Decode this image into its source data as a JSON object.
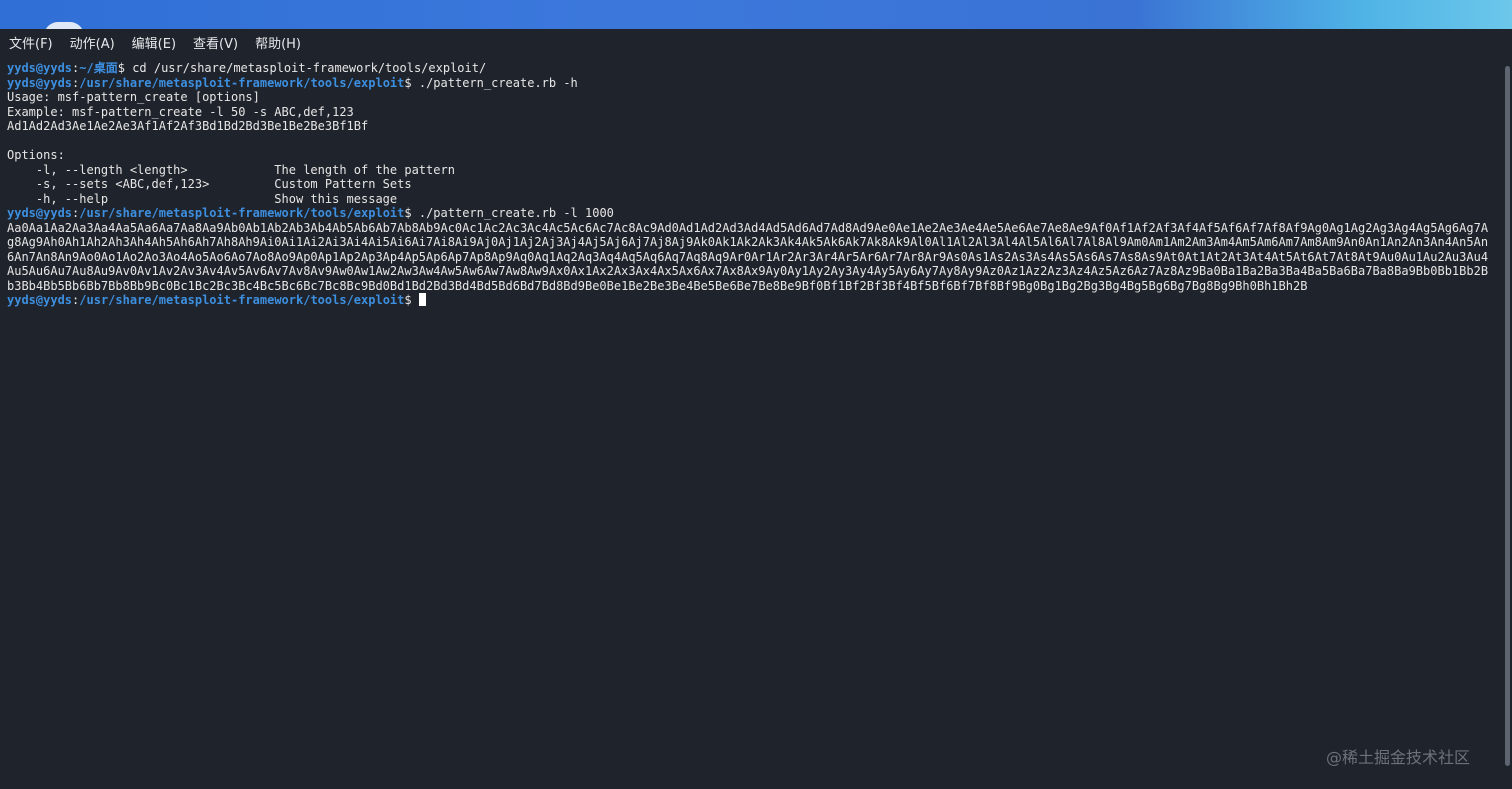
{
  "menubar": {
    "items": [
      "文件(F)",
      "动作(A)",
      "编辑(E)",
      "查看(V)",
      "帮助(H)"
    ]
  },
  "terminal": {
    "prompts": [
      {
        "user": "yyds@yyds",
        "path": "~/桌面",
        "command": "cd /usr/share/metasploit-framework/tools/exploit/"
      },
      {
        "user": "yyds@yyds",
        "path": "/usr/share/metasploit-framework/tools/exploit",
        "command": "./pattern_create.rb -h"
      }
    ],
    "help_lines": [
      "Usage: msf-pattern_create [options]",
      "Example: msf-pattern_create -l 50 -s ABC,def,123",
      "Ad1Ad2Ad3Ae1Ae2Ae3Af1Af2Af3Bd1Bd2Bd3Be1Be2Be3Bf1Bf",
      "",
      "Options:",
      "    -l, --length <length>            The length of the pattern",
      "    -s, --sets <ABC,def,123>         Custom Pattern Sets",
      "    -h, --help                       Show this message"
    ],
    "prompt3": {
      "user": "yyds@yyds",
      "path": "/usr/share/metasploit-framework/tools/exploit",
      "command": "./pattern_create.rb -l 1000"
    },
    "pattern_lines": [
      "Aa0Aa1Aa2Aa3Aa4Aa5Aa6Aa7Aa8Aa9Ab0Ab1Ab2Ab3Ab4Ab5Ab6Ab7Ab8Ab9Ac0Ac1Ac2Ac3Ac4Ac5Ac6Ac7Ac8Ac9Ad0Ad1Ad2Ad3Ad4Ad5Ad6Ad7Ad8Ad9Ae0Ae1Ae2Ae3Ae4Ae5Ae6Ae7Ae8Ae9Af0Af1Af2Af3Af4Af5Af6Af7Af8Af9Ag0Ag1Ag2Ag3Ag4Ag5Ag6Ag7A",
      "g8Ag9Ah0Ah1Ah2Ah3Ah4Ah5Ah6Ah7Ah8Ah9Ai0Ai1Ai2Ai3Ai4Ai5Ai6Ai7Ai8Ai9Aj0Aj1Aj2Aj3Aj4Aj5Aj6Aj7Aj8Aj9Ak0Ak1Ak2Ak3Ak4Ak5Ak6Ak7Ak8Ak9Al0Al1Al2Al3Al4Al5Al6Al7Al8Al9Am0Am1Am2Am3Am4Am5Am6Am7Am8Am9An0An1An2An3An4An5An",
      "6An7An8An9Ao0Ao1Ao2Ao3Ao4Ao5Ao6Ao7Ao8Ao9Ap0Ap1Ap2Ap3Ap4Ap5Ap6Ap7Ap8Ap9Aq0Aq1Aq2Aq3Aq4Aq5Aq6Aq7Aq8Aq9Ar0Ar1Ar2Ar3Ar4Ar5Ar6Ar7Ar8Ar9As0As1As2As3As4As5As6As7As8As9At0At1At2At3At4At5At6At7At8At9Au0Au1Au2Au3Au4",
      "Au5Au6Au7Au8Au9Av0Av1Av2Av3Av4Av5Av6Av7Av8Av9Aw0Aw1Aw2Aw3Aw4Aw5Aw6Aw7Aw8Aw9Ax0Ax1Ax2Ax3Ax4Ax5Ax6Ax7Ax8Ax9Ay0Ay1Ay2Ay3Ay4Ay5Ay6Ay7Ay8Ay9Az0Az1Az2Az3Az4Az5Az6Az7Az8Az9Ba0Ba1Ba2Ba3Ba4Ba5Ba6Ba7Ba8Ba9Bb0Bb1Bb2B",
      "b3Bb4Bb5Bb6Bb7Bb8Bb9Bc0Bc1Bc2Bc3Bc4Bc5Bc6Bc7Bc8Bc9Bd0Bd1Bd2Bd3Bd4Bd5Bd6Bd7Bd8Bd9Be0Be1Be2Be3Be4Be5Be6Be7Be8Be9Bf0Bf1Bf2Bf3Bf4Bf5Bf6Bf7Bf8Bf9Bg0Bg1Bg2Bg3Bg4Bg5Bg6Bg7Bg8Bg9Bh0Bh1Bh2B"
    ],
    "prompt4": {
      "user": "yyds@yyds",
      "path": "/usr/share/metasploit-framework/tools/exploit",
      "command": ""
    },
    "prompt_separator": ":",
    "prompt_symbol": "$"
  },
  "watermark": "@稀土掘金技术社区"
}
